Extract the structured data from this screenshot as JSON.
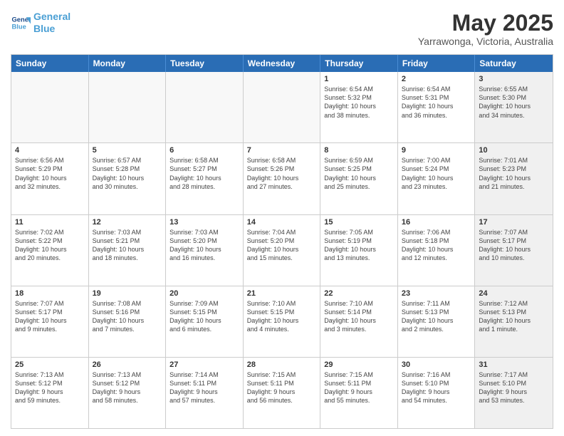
{
  "header": {
    "logo_line1": "General",
    "logo_line2": "Blue",
    "month": "May 2025",
    "location": "Yarrawonga, Victoria, Australia"
  },
  "weekdays": [
    "Sunday",
    "Monday",
    "Tuesday",
    "Wednesday",
    "Thursday",
    "Friday",
    "Saturday"
  ],
  "rows": [
    [
      {
        "day": "",
        "text": "",
        "empty": true
      },
      {
        "day": "",
        "text": "",
        "empty": true
      },
      {
        "day": "",
        "text": "",
        "empty": true
      },
      {
        "day": "",
        "text": "",
        "empty": true
      },
      {
        "day": "1",
        "text": "Sunrise: 6:54 AM\nSunset: 5:32 PM\nDaylight: 10 hours\nand 38 minutes.",
        "empty": false
      },
      {
        "day": "2",
        "text": "Sunrise: 6:54 AM\nSunset: 5:31 PM\nDaylight: 10 hours\nand 36 minutes.",
        "empty": false
      },
      {
        "day": "3",
        "text": "Sunrise: 6:55 AM\nSunset: 5:30 PM\nDaylight: 10 hours\nand 34 minutes.",
        "empty": false,
        "shaded": true
      }
    ],
    [
      {
        "day": "4",
        "text": "Sunrise: 6:56 AM\nSunset: 5:29 PM\nDaylight: 10 hours\nand 32 minutes.",
        "empty": false
      },
      {
        "day": "5",
        "text": "Sunrise: 6:57 AM\nSunset: 5:28 PM\nDaylight: 10 hours\nand 30 minutes.",
        "empty": false
      },
      {
        "day": "6",
        "text": "Sunrise: 6:58 AM\nSunset: 5:27 PM\nDaylight: 10 hours\nand 28 minutes.",
        "empty": false
      },
      {
        "day": "7",
        "text": "Sunrise: 6:58 AM\nSunset: 5:26 PM\nDaylight: 10 hours\nand 27 minutes.",
        "empty": false
      },
      {
        "day": "8",
        "text": "Sunrise: 6:59 AM\nSunset: 5:25 PM\nDaylight: 10 hours\nand 25 minutes.",
        "empty": false
      },
      {
        "day": "9",
        "text": "Sunrise: 7:00 AM\nSunset: 5:24 PM\nDaylight: 10 hours\nand 23 minutes.",
        "empty": false
      },
      {
        "day": "10",
        "text": "Sunrise: 7:01 AM\nSunset: 5:23 PM\nDaylight: 10 hours\nand 21 minutes.",
        "empty": false,
        "shaded": true
      }
    ],
    [
      {
        "day": "11",
        "text": "Sunrise: 7:02 AM\nSunset: 5:22 PM\nDaylight: 10 hours\nand 20 minutes.",
        "empty": false
      },
      {
        "day": "12",
        "text": "Sunrise: 7:03 AM\nSunset: 5:21 PM\nDaylight: 10 hours\nand 18 minutes.",
        "empty": false
      },
      {
        "day": "13",
        "text": "Sunrise: 7:03 AM\nSunset: 5:20 PM\nDaylight: 10 hours\nand 16 minutes.",
        "empty": false
      },
      {
        "day": "14",
        "text": "Sunrise: 7:04 AM\nSunset: 5:20 PM\nDaylight: 10 hours\nand 15 minutes.",
        "empty": false
      },
      {
        "day": "15",
        "text": "Sunrise: 7:05 AM\nSunset: 5:19 PM\nDaylight: 10 hours\nand 13 minutes.",
        "empty": false
      },
      {
        "day": "16",
        "text": "Sunrise: 7:06 AM\nSunset: 5:18 PM\nDaylight: 10 hours\nand 12 minutes.",
        "empty": false
      },
      {
        "day": "17",
        "text": "Sunrise: 7:07 AM\nSunset: 5:17 PM\nDaylight: 10 hours\nand 10 minutes.",
        "empty": false,
        "shaded": true
      }
    ],
    [
      {
        "day": "18",
        "text": "Sunrise: 7:07 AM\nSunset: 5:17 PM\nDaylight: 10 hours\nand 9 minutes.",
        "empty": false
      },
      {
        "day": "19",
        "text": "Sunrise: 7:08 AM\nSunset: 5:16 PM\nDaylight: 10 hours\nand 7 minutes.",
        "empty": false
      },
      {
        "day": "20",
        "text": "Sunrise: 7:09 AM\nSunset: 5:15 PM\nDaylight: 10 hours\nand 6 minutes.",
        "empty": false
      },
      {
        "day": "21",
        "text": "Sunrise: 7:10 AM\nSunset: 5:15 PM\nDaylight: 10 hours\nand 4 minutes.",
        "empty": false
      },
      {
        "day": "22",
        "text": "Sunrise: 7:10 AM\nSunset: 5:14 PM\nDaylight: 10 hours\nand 3 minutes.",
        "empty": false
      },
      {
        "day": "23",
        "text": "Sunrise: 7:11 AM\nSunset: 5:13 PM\nDaylight: 10 hours\nand 2 minutes.",
        "empty": false
      },
      {
        "day": "24",
        "text": "Sunrise: 7:12 AM\nSunset: 5:13 PM\nDaylight: 10 hours\nand 1 minute.",
        "empty": false,
        "shaded": true
      }
    ],
    [
      {
        "day": "25",
        "text": "Sunrise: 7:13 AM\nSunset: 5:12 PM\nDaylight: 9 hours\nand 59 minutes.",
        "empty": false
      },
      {
        "day": "26",
        "text": "Sunrise: 7:13 AM\nSunset: 5:12 PM\nDaylight: 9 hours\nand 58 minutes.",
        "empty": false
      },
      {
        "day": "27",
        "text": "Sunrise: 7:14 AM\nSunset: 5:11 PM\nDaylight: 9 hours\nand 57 minutes.",
        "empty": false
      },
      {
        "day": "28",
        "text": "Sunrise: 7:15 AM\nSunset: 5:11 PM\nDaylight: 9 hours\nand 56 minutes.",
        "empty": false
      },
      {
        "day": "29",
        "text": "Sunrise: 7:15 AM\nSunset: 5:11 PM\nDaylight: 9 hours\nand 55 minutes.",
        "empty": false
      },
      {
        "day": "30",
        "text": "Sunrise: 7:16 AM\nSunset: 5:10 PM\nDaylight: 9 hours\nand 54 minutes.",
        "empty": false
      },
      {
        "day": "31",
        "text": "Sunrise: 7:17 AM\nSunset: 5:10 PM\nDaylight: 9 hours\nand 53 minutes.",
        "empty": false,
        "shaded": true
      }
    ]
  ]
}
